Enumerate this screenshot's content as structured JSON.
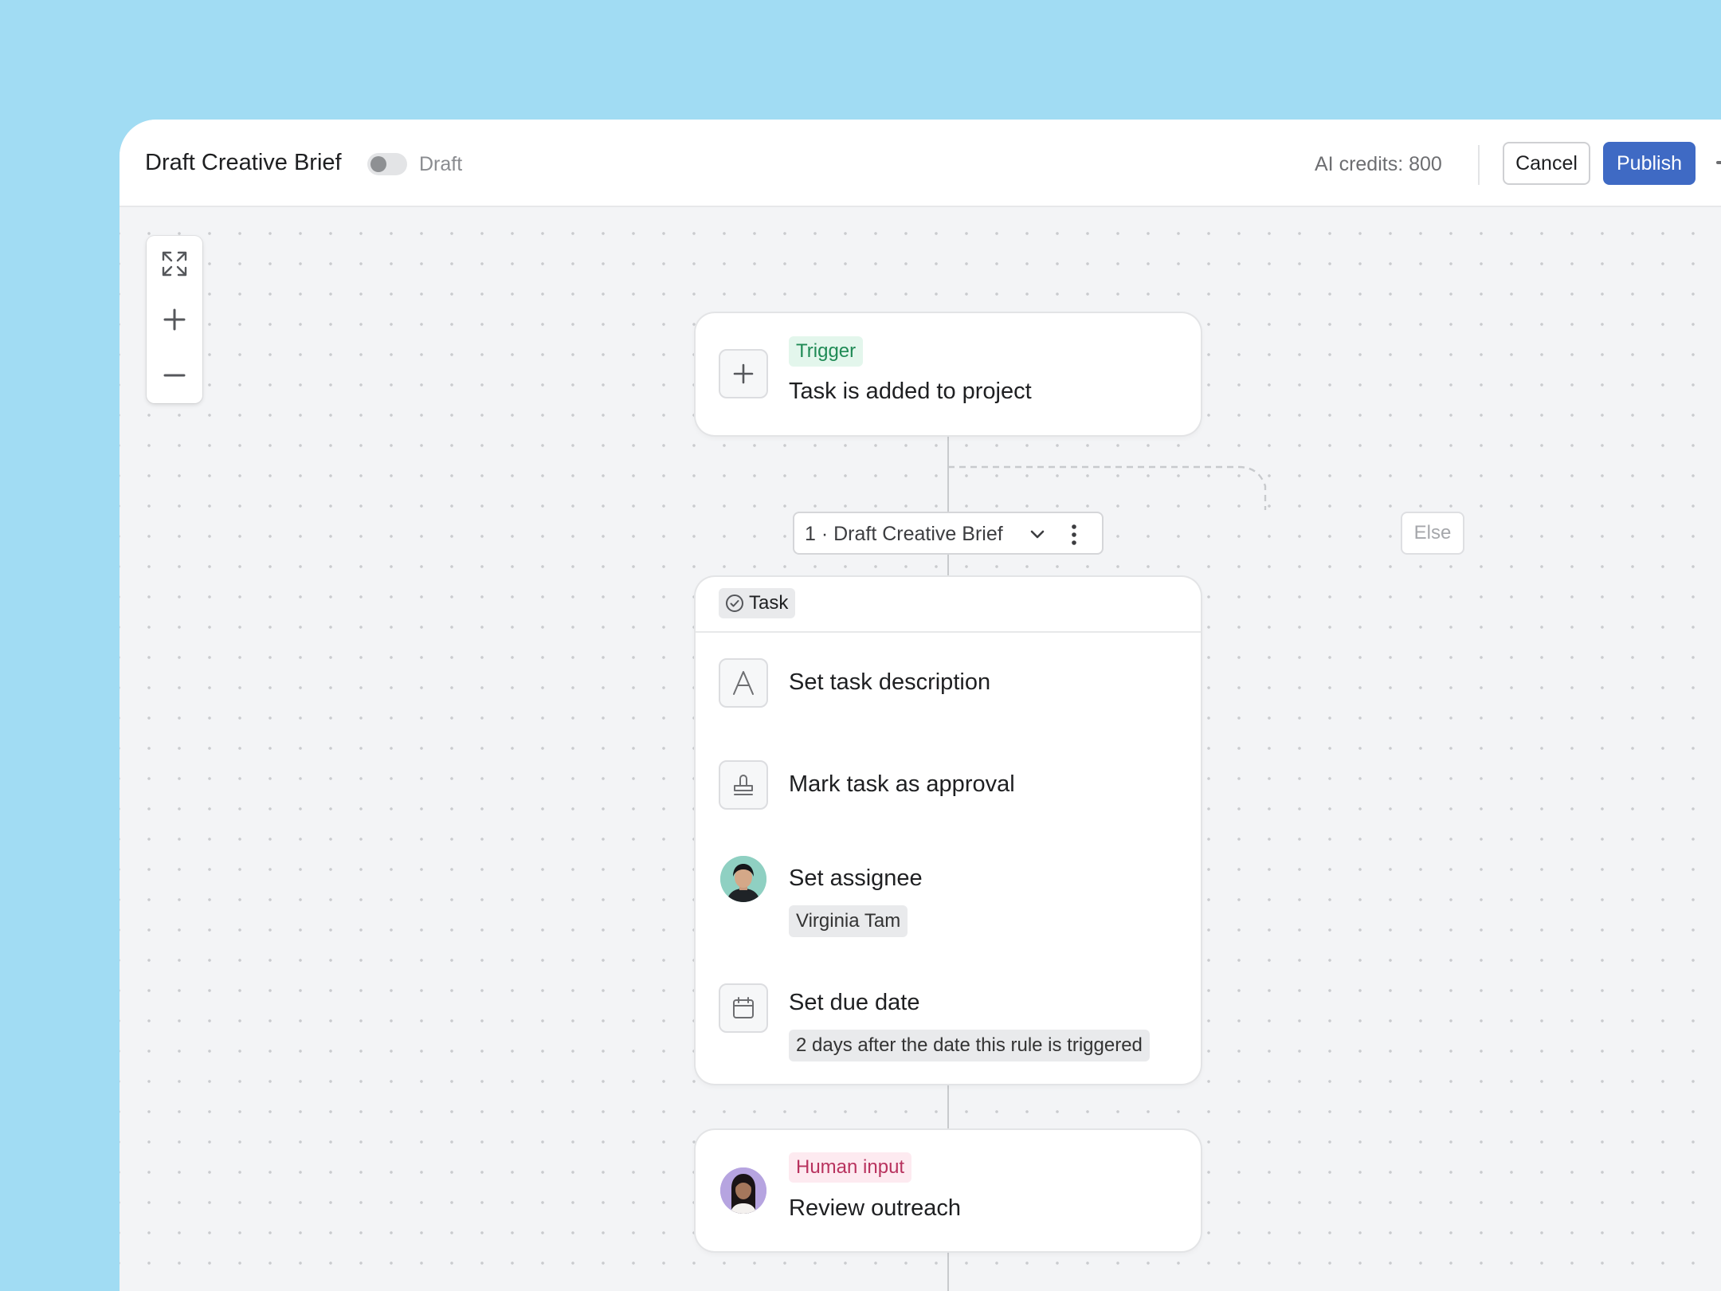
{
  "header": {
    "title": "Draft Creative Brief",
    "status_label": "Draft",
    "credits": "AI credits: 800",
    "cancel_label": "Cancel",
    "publish_label": "Publish"
  },
  "trigger": {
    "badge": "Trigger",
    "title": "Task is added to project"
  },
  "step_selector": {
    "label": "1 · Draft Creative Brief"
  },
  "else_label": "Else",
  "task_card": {
    "badge": "Task",
    "rows": [
      {
        "title": "Set task description",
        "icon": "text-icon"
      },
      {
        "title": "Mark task as approval",
        "icon": "stamp-icon"
      },
      {
        "title": "Set assignee",
        "value": "Virginia Tam",
        "icon": "avatar"
      },
      {
        "title": "Set due date",
        "value": "2 days after the date this rule is triggered",
        "icon": "calendar-icon"
      }
    ]
  },
  "human_input": {
    "badge": "Human input",
    "title": "Review outreach"
  },
  "colors": {
    "background": "#a1dcf3",
    "publish": "#3f6ac4",
    "trigger_badge_bg": "#e3f6ec",
    "trigger_badge_fg": "#1f8a55",
    "human_badge_bg": "#fdeaf0",
    "human_badge_fg": "#b8325e"
  }
}
